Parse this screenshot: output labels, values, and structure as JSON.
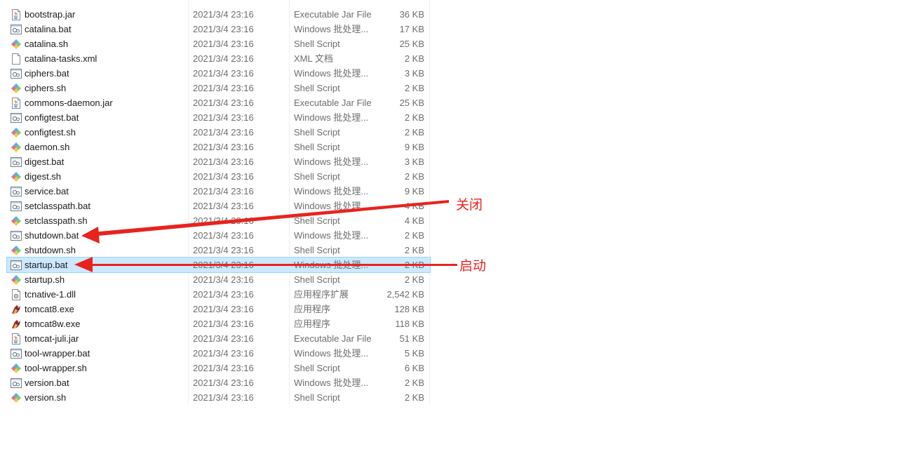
{
  "files": [
    {
      "name": "bootstrap.jar",
      "date": "2021/3/4 23:16",
      "type": "Executable Jar File",
      "size": "36 KB",
      "icon": "jar-icon"
    },
    {
      "name": "catalina.bat",
      "date": "2021/3/4 23:16",
      "type": "Windows 批处理...",
      "size": "17 KB",
      "icon": "bat-icon"
    },
    {
      "name": "catalina.sh",
      "date": "2021/3/4 23:16",
      "type": "Shell Script",
      "size": "25 KB",
      "icon": "sh-icon"
    },
    {
      "name": "catalina-tasks.xml",
      "date": "2021/3/4 23:16",
      "type": "XML 文档",
      "size": "2 KB",
      "icon": "xml-icon"
    },
    {
      "name": "ciphers.bat",
      "date": "2021/3/4 23:16",
      "type": "Windows 批处理...",
      "size": "3 KB",
      "icon": "bat-icon"
    },
    {
      "name": "ciphers.sh",
      "date": "2021/3/4 23:16",
      "type": "Shell Script",
      "size": "2 KB",
      "icon": "sh-icon"
    },
    {
      "name": "commons-daemon.jar",
      "date": "2021/3/4 23:16",
      "type": "Executable Jar File",
      "size": "25 KB",
      "icon": "jar-icon"
    },
    {
      "name": "configtest.bat",
      "date": "2021/3/4 23:16",
      "type": "Windows 批处理...",
      "size": "2 KB",
      "icon": "bat-icon"
    },
    {
      "name": "configtest.sh",
      "date": "2021/3/4 23:16",
      "type": "Shell Script",
      "size": "2 KB",
      "icon": "sh-icon"
    },
    {
      "name": "daemon.sh",
      "date": "2021/3/4 23:16",
      "type": "Shell Script",
      "size": "9 KB",
      "icon": "sh-icon"
    },
    {
      "name": "digest.bat",
      "date": "2021/3/4 23:16",
      "type": "Windows 批处理...",
      "size": "3 KB",
      "icon": "bat-icon"
    },
    {
      "name": "digest.sh",
      "date": "2021/3/4 23:16",
      "type": "Shell Script",
      "size": "2 KB",
      "icon": "sh-icon"
    },
    {
      "name": "service.bat",
      "date": "2021/3/4 23:16",
      "type": "Windows 批处理...",
      "size": "9 KB",
      "icon": "bat-icon"
    },
    {
      "name": "setclasspath.bat",
      "date": "2021/3/4 23:16",
      "type": "Windows 批处理...",
      "size": "4 KB",
      "icon": "bat-icon"
    },
    {
      "name": "setclasspath.sh",
      "date": "2021/3/4 23:16",
      "type": "Shell Script",
      "size": "4 KB",
      "icon": "sh-icon"
    },
    {
      "name": "shutdown.bat",
      "date": "2021/3/4 23:16",
      "type": "Windows 批处理...",
      "size": "2 KB",
      "icon": "bat-icon"
    },
    {
      "name": "shutdown.sh",
      "date": "2021/3/4 23:16",
      "type": "Shell Script",
      "size": "2 KB",
      "icon": "sh-icon"
    },
    {
      "name": "startup.bat",
      "date": "2021/3/4 23:16",
      "type": "Windows 批处理...",
      "size": "2 KB",
      "icon": "bat-icon",
      "selected": true
    },
    {
      "name": "startup.sh",
      "date": "2021/3/4 23:16",
      "type": "Shell Script",
      "size": "2 KB",
      "icon": "sh-icon"
    },
    {
      "name": "tcnative-1.dll",
      "date": "2021/3/4 23:16",
      "type": "应用程序扩展",
      "size": "2,542 KB",
      "icon": "dll-icon"
    },
    {
      "name": "tomcat8.exe",
      "date": "2021/3/4 23:16",
      "type": "应用程序",
      "size": "128 KB",
      "icon": "tomcat-exe-icon"
    },
    {
      "name": "tomcat8w.exe",
      "date": "2021/3/4 23:16",
      "type": "应用程序",
      "size": "118 KB",
      "icon": "tomcat-exe-icon"
    },
    {
      "name": "tomcat-juli.jar",
      "date": "2021/3/4 23:16",
      "type": "Executable Jar File",
      "size": "51 KB",
      "icon": "jar-icon"
    },
    {
      "name": "tool-wrapper.bat",
      "date": "2021/3/4 23:16",
      "type": "Windows 批处理...",
      "size": "5 KB",
      "icon": "bat-icon"
    },
    {
      "name": "tool-wrapper.sh",
      "date": "2021/3/4 23:16",
      "type": "Shell Script",
      "size": "6 KB",
      "icon": "sh-icon"
    },
    {
      "name": "version.bat",
      "date": "2021/3/4 23:16",
      "type": "Windows 批处理...",
      "size": "2 KB",
      "icon": "bat-icon"
    },
    {
      "name": "version.sh",
      "date": "2021/3/4 23:16",
      "type": "Shell Script",
      "size": "2 KB",
      "icon": "sh-icon"
    }
  ],
  "annotations": {
    "shutdown_label": "关闭",
    "startup_label": "启动",
    "color": "#e8231e"
  },
  "colors": {
    "selection_bg": "#cce8ff",
    "selection_border": "#99d1ff",
    "secondary_text": "#6d6d6d"
  }
}
